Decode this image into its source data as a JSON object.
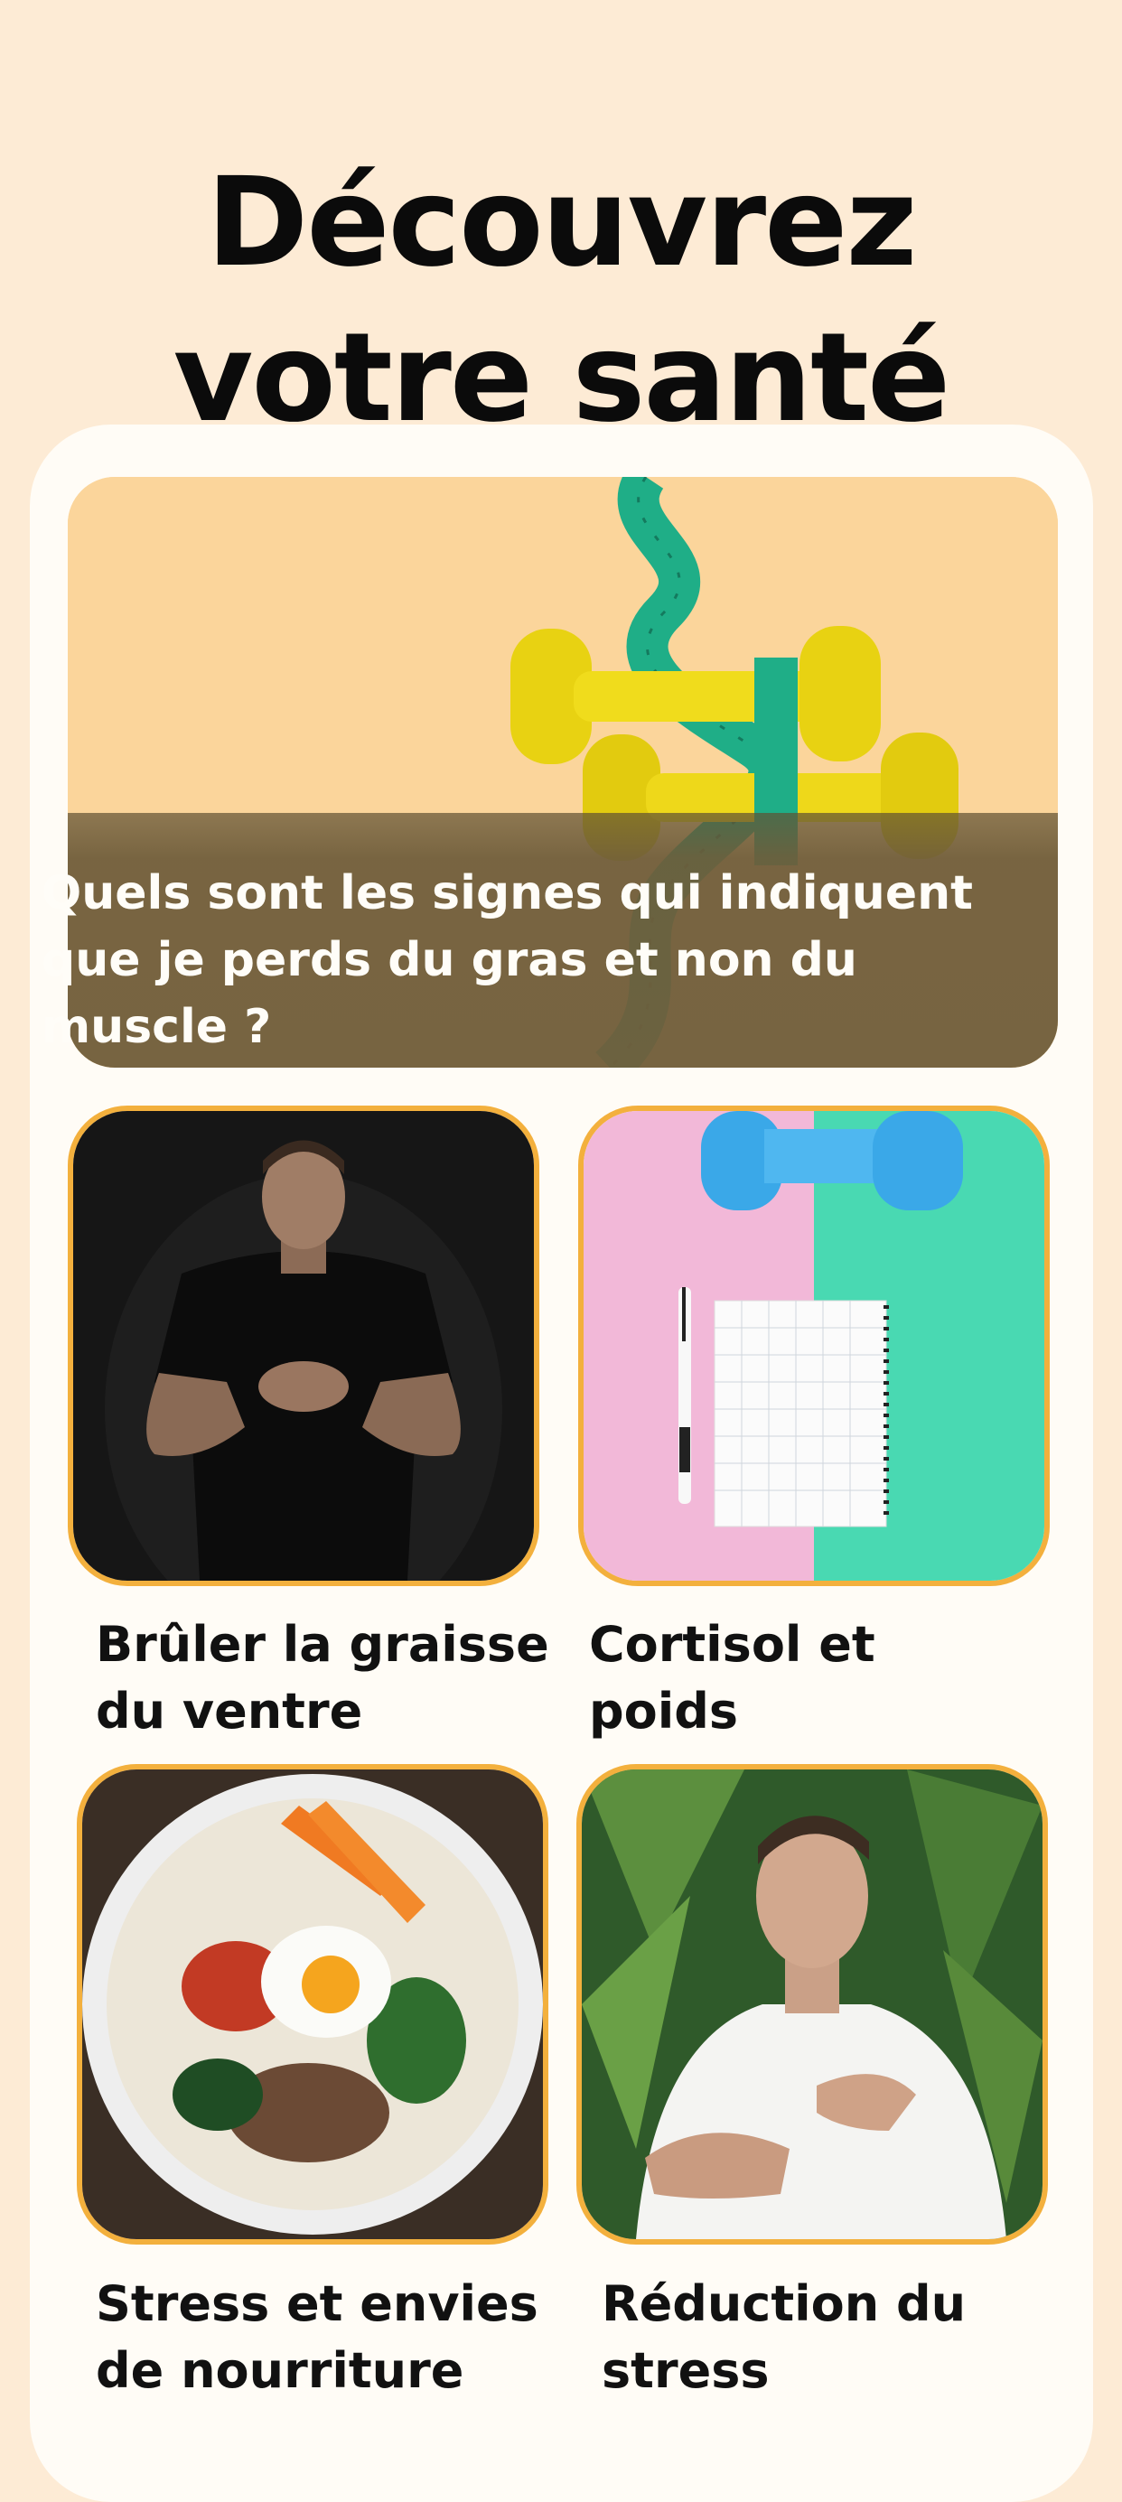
{
  "page": {
    "title_line1": "Découvrez",
    "title_line2": "votre santé"
  },
  "hero": {
    "image": "dumbbells-with-measuring-tape",
    "title": "Quels sont les signes qui indiquent que je perds du gras et non du muscle ?"
  },
  "articles": [
    {
      "image": "fit-man-in-black-tshirt",
      "label_line1": "Brûler la graisse",
      "label_line2": "du ventre"
    },
    {
      "image": "notebook-pen-and-blue-dumbbells",
      "label_line1": "Cortisol et",
      "label_line2": "poids"
    },
    {
      "image": "bibimbap-bowl",
      "label_line1": "Stress et envies",
      "label_line2": "de nourriture"
    },
    {
      "image": "man-breathing-calmly",
      "label_line1": "Réduction du",
      "label_line2": "stress"
    }
  ],
  "colors": {
    "background": "#fdebd5",
    "panel": "#fffcf6",
    "tile_border": "#f3b03d",
    "text": "#111111"
  }
}
